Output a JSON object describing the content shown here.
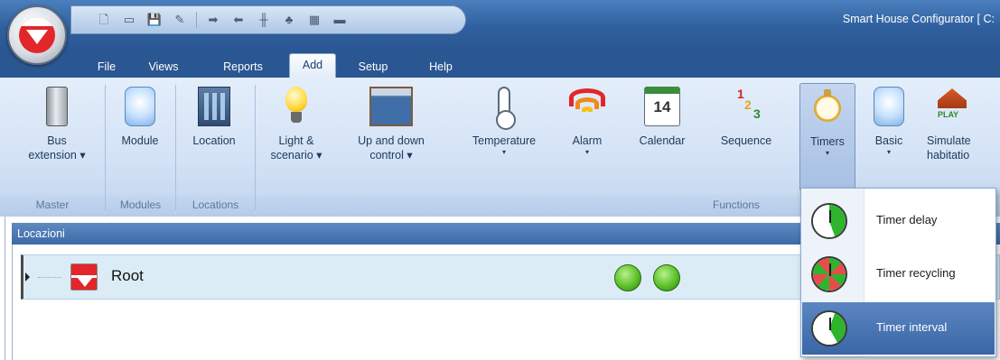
{
  "window": {
    "title": "Smart House Configurator [ C:"
  },
  "quick_access": {
    "buttons": [
      "new-icon",
      "open-icon",
      "save-icon",
      "edit-icon",
      "import-icon",
      "export-icon",
      "network-icon",
      "tree-icon",
      "palette-icon",
      "monitor-icon"
    ]
  },
  "menu": {
    "tabs": [
      {
        "label": "File"
      },
      {
        "label": "Views"
      },
      {
        "label": "Reports"
      },
      {
        "label": "Add",
        "active": true
      },
      {
        "label": "Setup"
      },
      {
        "label": "Help"
      }
    ]
  },
  "ribbon": {
    "buttons": {
      "bus_extension": {
        "line1": "Bus",
        "line2": "extension"
      },
      "module": {
        "label": "Module"
      },
      "location": {
        "label": "Location"
      },
      "light_scenario": {
        "line1": "Light &",
        "line2": "scenario"
      },
      "up_down": {
        "line1": "Up and down",
        "line2": "control"
      },
      "temperature": {
        "label": "Temperature"
      },
      "alarm": {
        "label": "Alarm"
      },
      "calendar": {
        "label": "Calendar",
        "day": "14"
      },
      "sequence": {
        "label": "Sequence",
        "d1": "1",
        "d2": "2",
        "d3": "3"
      },
      "timers": {
        "label": "Timers"
      },
      "basic": {
        "label": "Basic"
      },
      "simulate": {
        "line1": "Simulate",
        "line2": "habitatio",
        "badge": "PLAY"
      }
    },
    "groups": {
      "master": "Master",
      "modules": "Modules",
      "locations": "Locations",
      "functions": "Functions"
    },
    "dropdown_caret": "▾"
  },
  "locations_pane": {
    "title": "Locazioni",
    "tree": [
      {
        "label": "Root",
        "status": [
          "ok",
          "ok"
        ],
        "status_color": "#5cc12a"
      }
    ]
  },
  "timers_menu": {
    "items": [
      {
        "label": "Timer delay",
        "selected": false
      },
      {
        "label": "Timer recycling",
        "selected": false
      },
      {
        "label": "Timer interval",
        "selected": true
      }
    ]
  },
  "colors": {
    "accent": "#2a5791",
    "ribbon": "#d3e2f5",
    "selection": "#3a66a6",
    "brand_red": "#e3262b"
  }
}
